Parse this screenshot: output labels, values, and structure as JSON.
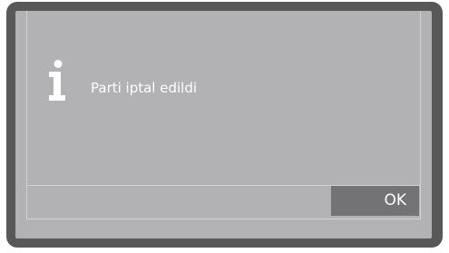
{
  "dialog": {
    "icon": "info-icon",
    "message": "Parti iptal edildi",
    "ok_label": "OK"
  },
  "colors": {
    "bezel": "#585858",
    "screen": "#b2b2b4",
    "button": "#737375",
    "text": "#ffffff"
  }
}
